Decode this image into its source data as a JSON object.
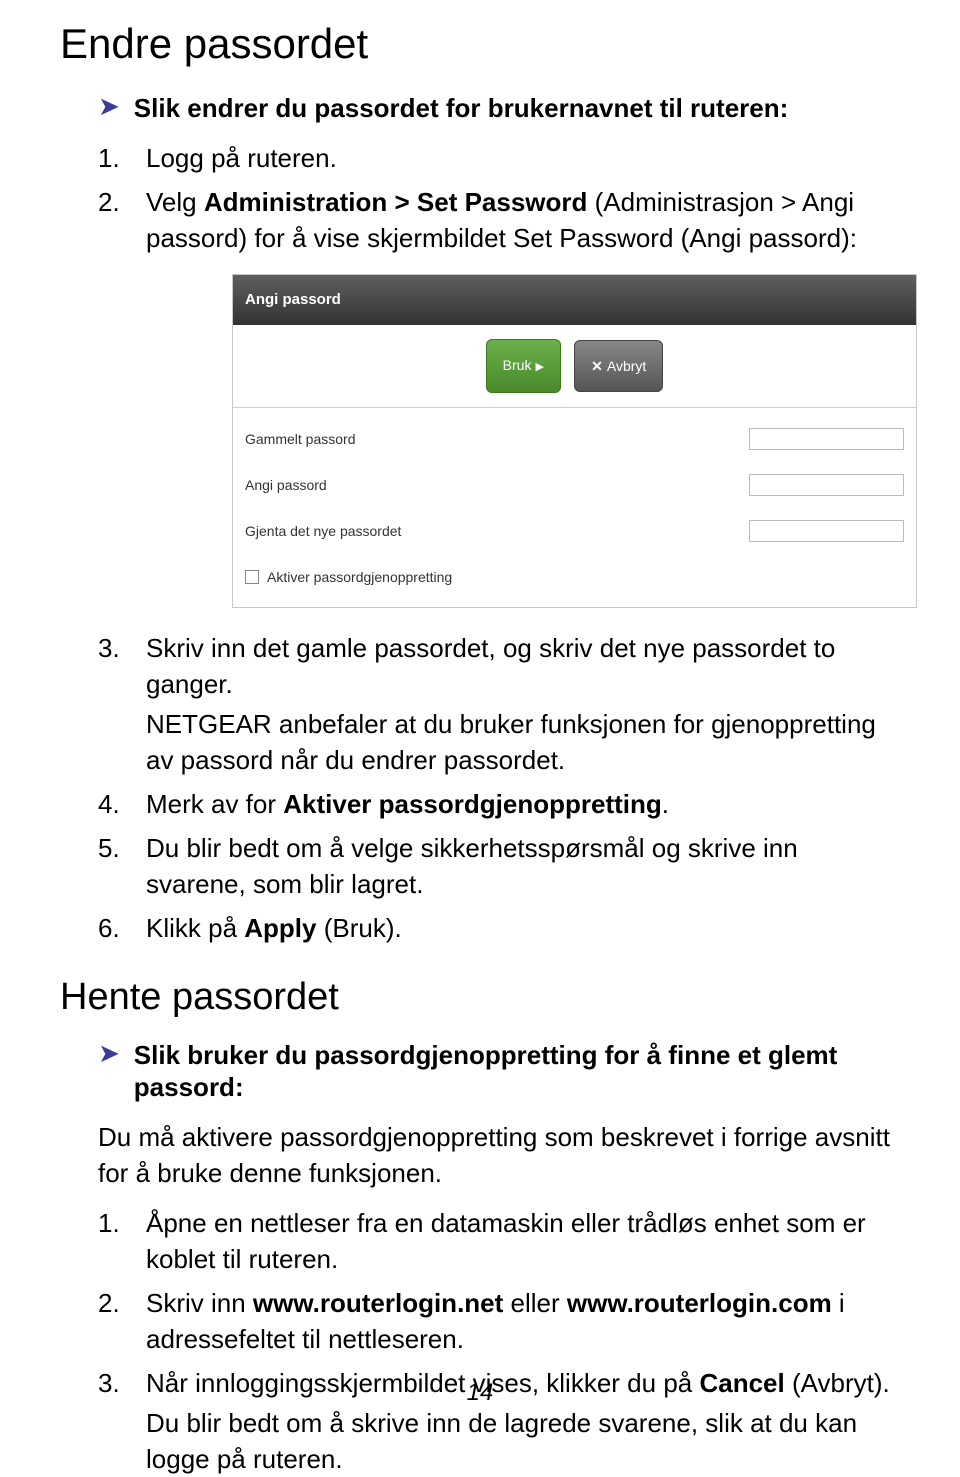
{
  "heading1": "Endre passordet",
  "arrow1": {
    "glyph": "➤",
    "text": "Slik endrer du passordet for brukernavnet til ruteren:"
  },
  "list1": {
    "i1": "Logg på ruteren.",
    "i2_pre": "Velg ",
    "i2_b1": "Administration > Set Password",
    "i2_mid": " (Administrasjon > Angi passord) for å vise skjermbildet Set Password (Angi passord):",
    "i3_a": "Skriv inn det gamle passordet, og skriv det nye passordet to ganger.",
    "i3_b": "NETGEAR anbefaler at du bruker funksjonen for gjenoppretting av passord når du endrer passordet.",
    "i4_pre": "Merk av for ",
    "i4_b": "Aktiver passordgjenoppretting",
    "i4_post": ".",
    "i5": "Du blir bedt om å velge sikkerhetsspørsmål og skrive inn svarene, som blir lagret.",
    "i6_pre": "Klikk på ",
    "i6_b": "Apply",
    "i6_post": " (Bruk)."
  },
  "widget": {
    "title": "Angi passord",
    "btn_apply": "Bruk",
    "btn_cancel": "Avbryt",
    "row1": "Gammelt passord",
    "row2": "Angi passord",
    "row3": "Gjenta det nye passordet",
    "check": "Aktiver passordgjenoppretting"
  },
  "heading2": "Hente passordet",
  "arrow2": {
    "glyph": "➤",
    "text": "Slik bruker du passordgjenoppretting for å finne et glemt passord:"
  },
  "para2": "Du må aktivere passordgjenoppretting som beskrevet i forrige avsnitt for å bruke denne funksjonen.",
  "list2": {
    "i1": "Åpne en nettleser fra en datamaskin eller trådløs enhet som er koblet til ruteren.",
    "i2_pre": "Skriv inn ",
    "i2_b1": "www.routerlogin.net",
    "i2_mid": " eller ",
    "i2_b2": "www.routerlogin.com",
    "i2_post": " i adressefeltet til nettleseren.",
    "i3_pre": "Når innloggingsskjermbildet vises, klikker du på ",
    "i3_b": "Cancel",
    "i3_post": " (Avbryt).",
    "i3_sub": "Du blir bedt om å skrive inn de lagrede svarene, slik at du kan logge på ruteren."
  },
  "page_number": "14"
}
